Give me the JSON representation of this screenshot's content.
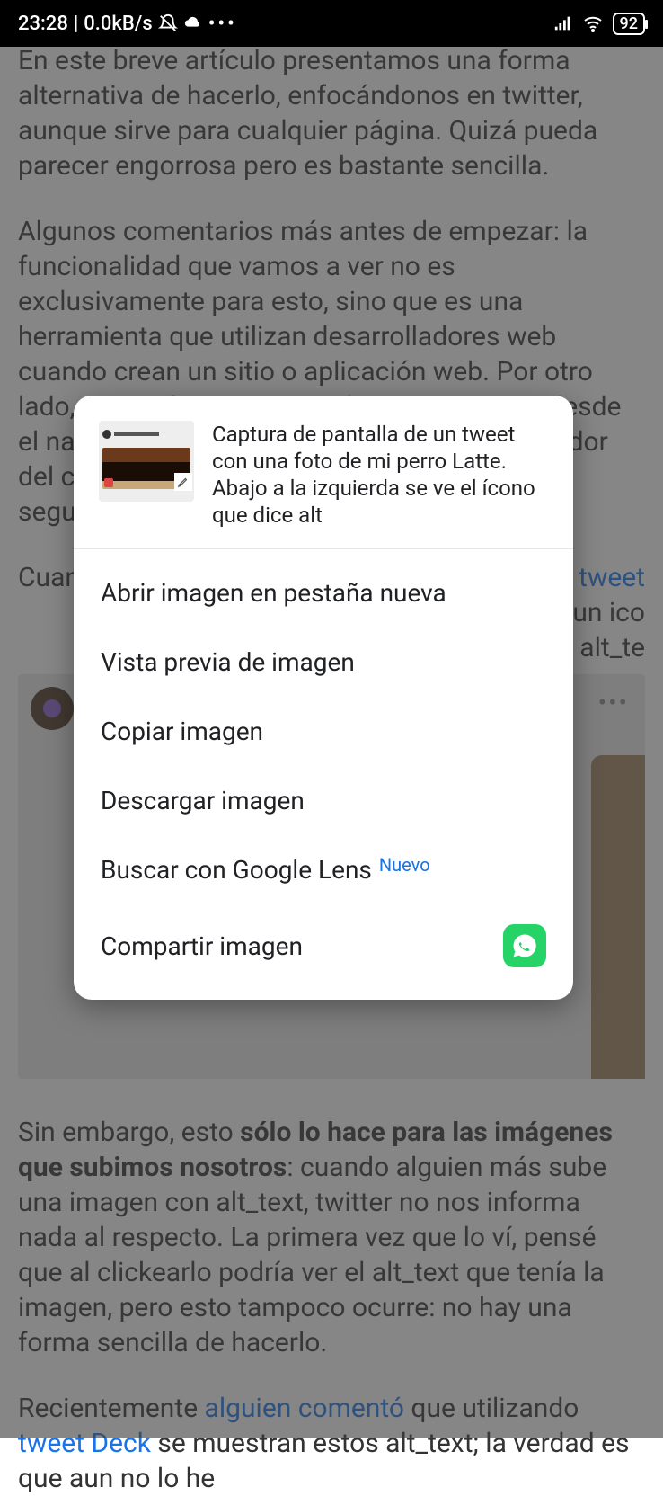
{
  "status": {
    "time": "23:28",
    "net_speed": "0.0kB/s",
    "battery": "92"
  },
  "article": {
    "p1": "En este breve artículo presentamos una forma alternativa de hacerlo, enfocándonos en twitter, aunque sirve para cualquier página. Quizá pueda parecer engorrosa pero es bastante sencilla.",
    "p2": "Algunos comentarios más antes de empezar: la funcionalidad que vamos a ver no es exclusivamente para esto, sino que es una herramienta que utilizan desarrolladores web cuando crean un sitio o aplicación web. Por otro lado, esto aplica para cuando vemos tweets desde el navegador de la computadora (en el navegador del celula",
    "p2b": "segur",
    "p3a": "Cuanc",
    "p3b_link": "te tweet",
    "p3c": "izquierda un ico",
    "p3d": "e un alt_te",
    "p4a": "Sin embargo, esto ",
    "p4b_bold": "sólo lo hace para las imágenes que subimos nosotros",
    "p4c": ": cuando alguien más sube una imagen con alt_text, twitter no nos informa nada al respecto. La primera vez que lo ví, pensé que al clickearlo podría ver el alt_text que tenía la imagen, pero esto tampoco ocurre: no hay una forma sencilla de hacerlo.",
    "p5a": "Recientemente ",
    "p5b_link": "alguien comentó",
    "p5c": " que utilizando ",
    "p5d_link": "tweet Deck",
    "p5e": " se muestran estos alt_text; la verdad es que aun no lo he"
  },
  "context_menu": {
    "title": "Captura de pantalla de un tweet con una foto de mi perro Latte. Abajo a la izquierda se ve el ícono que dice alt",
    "items": [
      {
        "label": "Abrir imagen en pestaña nueva",
        "badge": "",
        "icon": ""
      },
      {
        "label": "Vista previa de imagen",
        "badge": "",
        "icon": ""
      },
      {
        "label": "Copiar imagen",
        "badge": "",
        "icon": ""
      },
      {
        "label": "Descargar imagen",
        "badge": "",
        "icon": ""
      },
      {
        "label": "Buscar con Google Lens",
        "badge": "Nuevo",
        "icon": ""
      },
      {
        "label": "Compartir imagen",
        "badge": "",
        "icon": "whatsapp"
      }
    ]
  }
}
